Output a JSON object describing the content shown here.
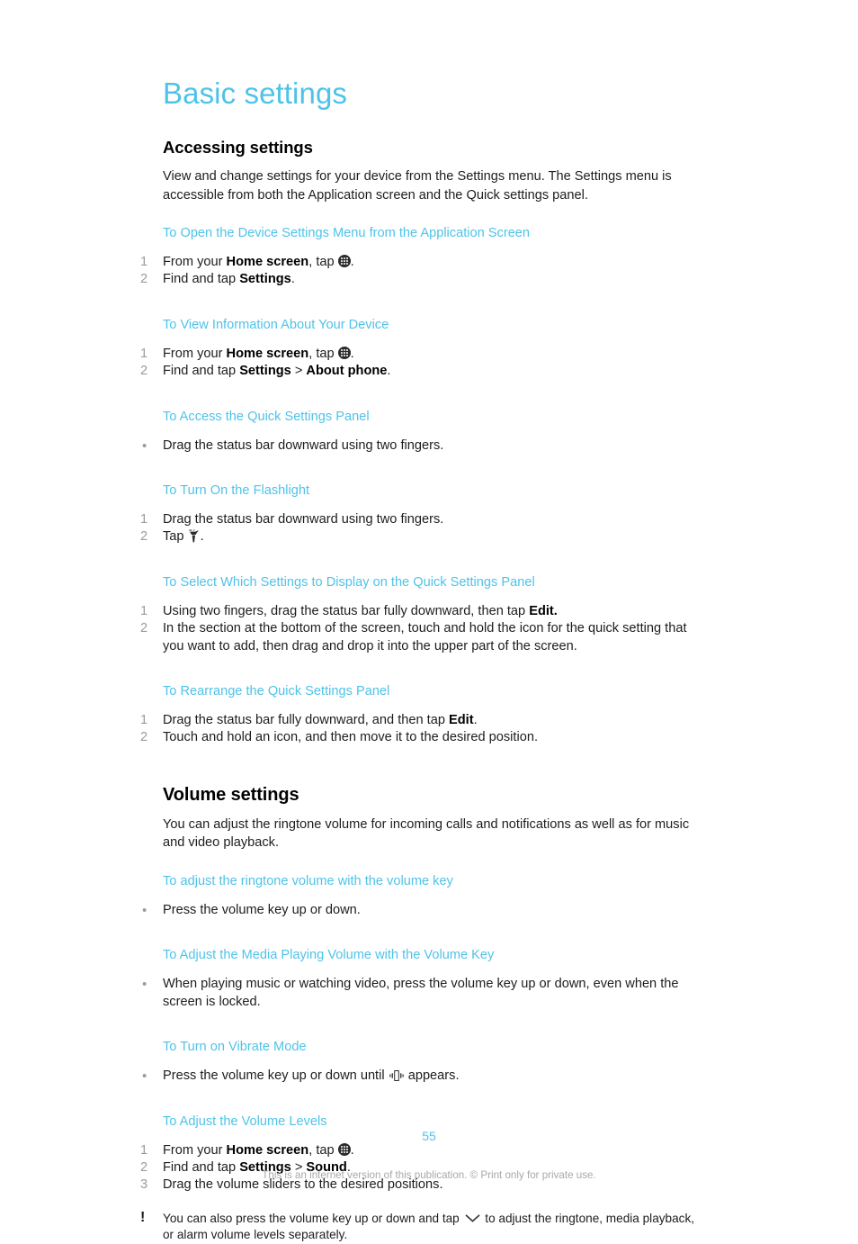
{
  "document": {
    "title": "Basic settings",
    "page_number": "55",
    "footer_note": "This is an internet version of this publication. © Print only for private use.",
    "accent_color": "#4ec3e8",
    "body_color": "#1d1d1d",
    "marker_color": "#9b9b9b"
  },
  "sections": [
    {
      "heading": "Accessing settings",
      "intro": "View and change settings for your device from the Settings menu. The Settings menu is accessible from both the Application screen and the Quick settings panel.",
      "procedures": [
        {
          "title": "To Open the Device Settings Menu from the Application Screen",
          "markers": [
            "1",
            "2"
          ],
          "steps": [
            "From your Home screen, tap .",
            "Find and tap Settings."
          ]
        },
        {
          "title": "To View Information About Your Device",
          "markers": [
            "1",
            "2"
          ],
          "steps": [
            "From your Home screen, tap .",
            "Find and tap Settings > About phone."
          ]
        },
        {
          "title": "To Access the Quick Settings Panel",
          "markers": [
            "•"
          ],
          "steps": [
            "Drag the status bar downward using two fingers."
          ]
        },
        {
          "title": "To Turn On the Flashlight",
          "markers": [
            "1",
            "2"
          ],
          "steps": [
            "Drag the status bar downward using two fingers.",
            "Tap ."
          ]
        },
        {
          "title": "To Select Which Settings to Display on the Quick Settings Panel",
          "markers": [
            "1",
            "2"
          ],
          "steps": [
            "Using two fingers, drag the status bar fully downward, then tap Edit.",
            "In the section at the bottom of the screen, touch and hold the icon for the quick setting that you want to add, then drag and drop it into the upper part of the screen."
          ]
        },
        {
          "title": "To Rearrange the Quick Settings Panel",
          "markers": [
            "1",
            "2"
          ],
          "steps": [
            "Drag the status bar fully downward, and then tap Edit.",
            "Touch and hold an icon, and then move it to the desired position."
          ]
        }
      ]
    },
    {
      "heading": "Volume settings",
      "intro": "You can adjust the ringtone volume for incoming calls and notifications as well as for music and video playback.",
      "procedures": [
        {
          "title": "To adjust the ringtone volume with the volume key",
          "markers": [
            "•"
          ],
          "steps": [
            "Press the volume key up or down."
          ]
        },
        {
          "title": "To Adjust the Media Playing Volume with the Volume Key",
          "markers": [
            "•"
          ],
          "steps": [
            "When playing music or watching video, press the volume key up or down, even when the screen is locked."
          ]
        },
        {
          "title": "To Turn on Vibrate Mode",
          "markers": [
            "•"
          ],
          "steps": [
            "Press the volume key up or down until  appears."
          ]
        },
        {
          "title": "To Adjust the Volume Levels",
          "markers": [
            "1",
            "2",
            "3"
          ],
          "steps": [
            "From your Home screen, tap .",
            "Find and tap Settings > Sound.",
            "Drag the volume sliders to the desired positions."
          ]
        }
      ],
      "tip": {
        "marker": "!",
        "text": "You can also press the volume key up or down and tap  to adjust the ringtone, media playback, or alarm volume levels separately."
      }
    }
  ],
  "text_fragments": {
    "from_your": "From your ",
    "home_screen": "Home screen",
    "comma_tap": ", tap ",
    "period": ".",
    "find_and_tap": "Find and tap ",
    "settings": "Settings",
    "about_phone": "About phone",
    "sound": "Sound",
    "gt": " > ",
    "tap": "Tap ",
    "drag_status_two_fingers": "Drag the status bar downward using two fingers.",
    "using_two_fingers_pre": "Using two fingers, drag the status bar fully downward, then tap ",
    "edit": "Edit",
    "edit_dot_bold": "Edit.",
    "step_add_quick": "In the section at the bottom of the screen, touch and hold the icon for the quick setting that you want to add, then drag and drop it into the upper part of the screen.",
    "drag_fully_pre": "Drag the status bar fully downward, and then tap ",
    "touch_hold_move": "Touch and hold an icon, and then move it to the desired position.",
    "press_volume_key": "Press the volume key up or down.",
    "media_volume_step": "When playing music or watching video, press the volume key up or down, even when the screen is locked.",
    "vibrate_pre": "Press the volume key up or down until ",
    "vibrate_post": " appears.",
    "drag_sliders": "Drag the volume sliders to the desired positions.",
    "tip_pre": "You can also press the volume key up or down and tap ",
    "tip_post": " to adjust the ringtone, media playback, or alarm volume levels separately."
  },
  "icons": {
    "app_drawer": "app-drawer-icon",
    "flashlight": "flashlight-icon",
    "vibrate": "vibrate-icon",
    "chevron_down": "chevron-down-icon",
    "tip_exclamation": "!"
  }
}
